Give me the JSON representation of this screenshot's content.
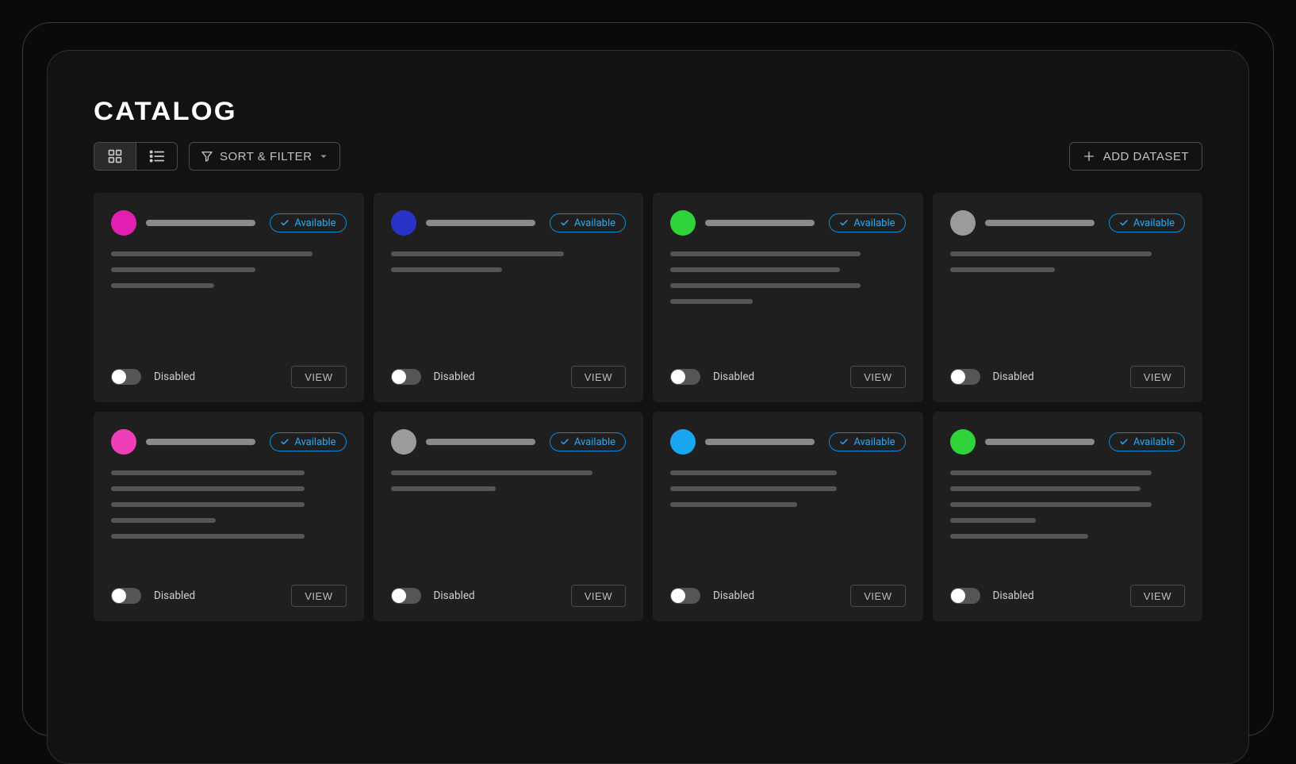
{
  "header": {
    "title": "CATALOG",
    "sort_filter_label": "SORT & FILTER",
    "add_dataset_label": "ADD DATASET"
  },
  "status": {
    "available": "Available"
  },
  "card_labels": {
    "toggle_off": "Disabled",
    "view": "VIEW"
  },
  "cards": [
    {
      "color": "#e21fb0",
      "title_w": 138,
      "lines": [
        254,
        182,
        130
      ],
      "status": "available",
      "enabled": false
    },
    {
      "color": "#2a33c8",
      "title_w": 138,
      "lines": [
        218,
        140
      ],
      "status": "available",
      "enabled": false
    },
    {
      "color": "#2fd33a",
      "title_w": 138,
      "lines": [
        240,
        214,
        240,
        104
      ],
      "status": "available",
      "enabled": false
    },
    {
      "color": "#9b9b9b",
      "title_w": 138,
      "lines": [
        254,
        132
      ],
      "status": "available",
      "enabled": false
    },
    {
      "color": "#ef3fb8",
      "title_w": 138,
      "lines": [
        244,
        244,
        244,
        132,
        244
      ],
      "status": "available",
      "enabled": false
    },
    {
      "color": "#9b9b9b",
      "title_w": 138,
      "lines": [
        254,
        132
      ],
      "status": "available",
      "enabled": false
    },
    {
      "color": "#1aa6ee",
      "title_w": 138,
      "lines": [
        210,
        210,
        160
      ],
      "status": "available",
      "enabled": false
    },
    {
      "color": "#2fd33a",
      "title_w": 138,
      "lines": [
        254,
        240,
        254,
        108,
        174
      ],
      "status": "available",
      "enabled": false
    }
  ]
}
